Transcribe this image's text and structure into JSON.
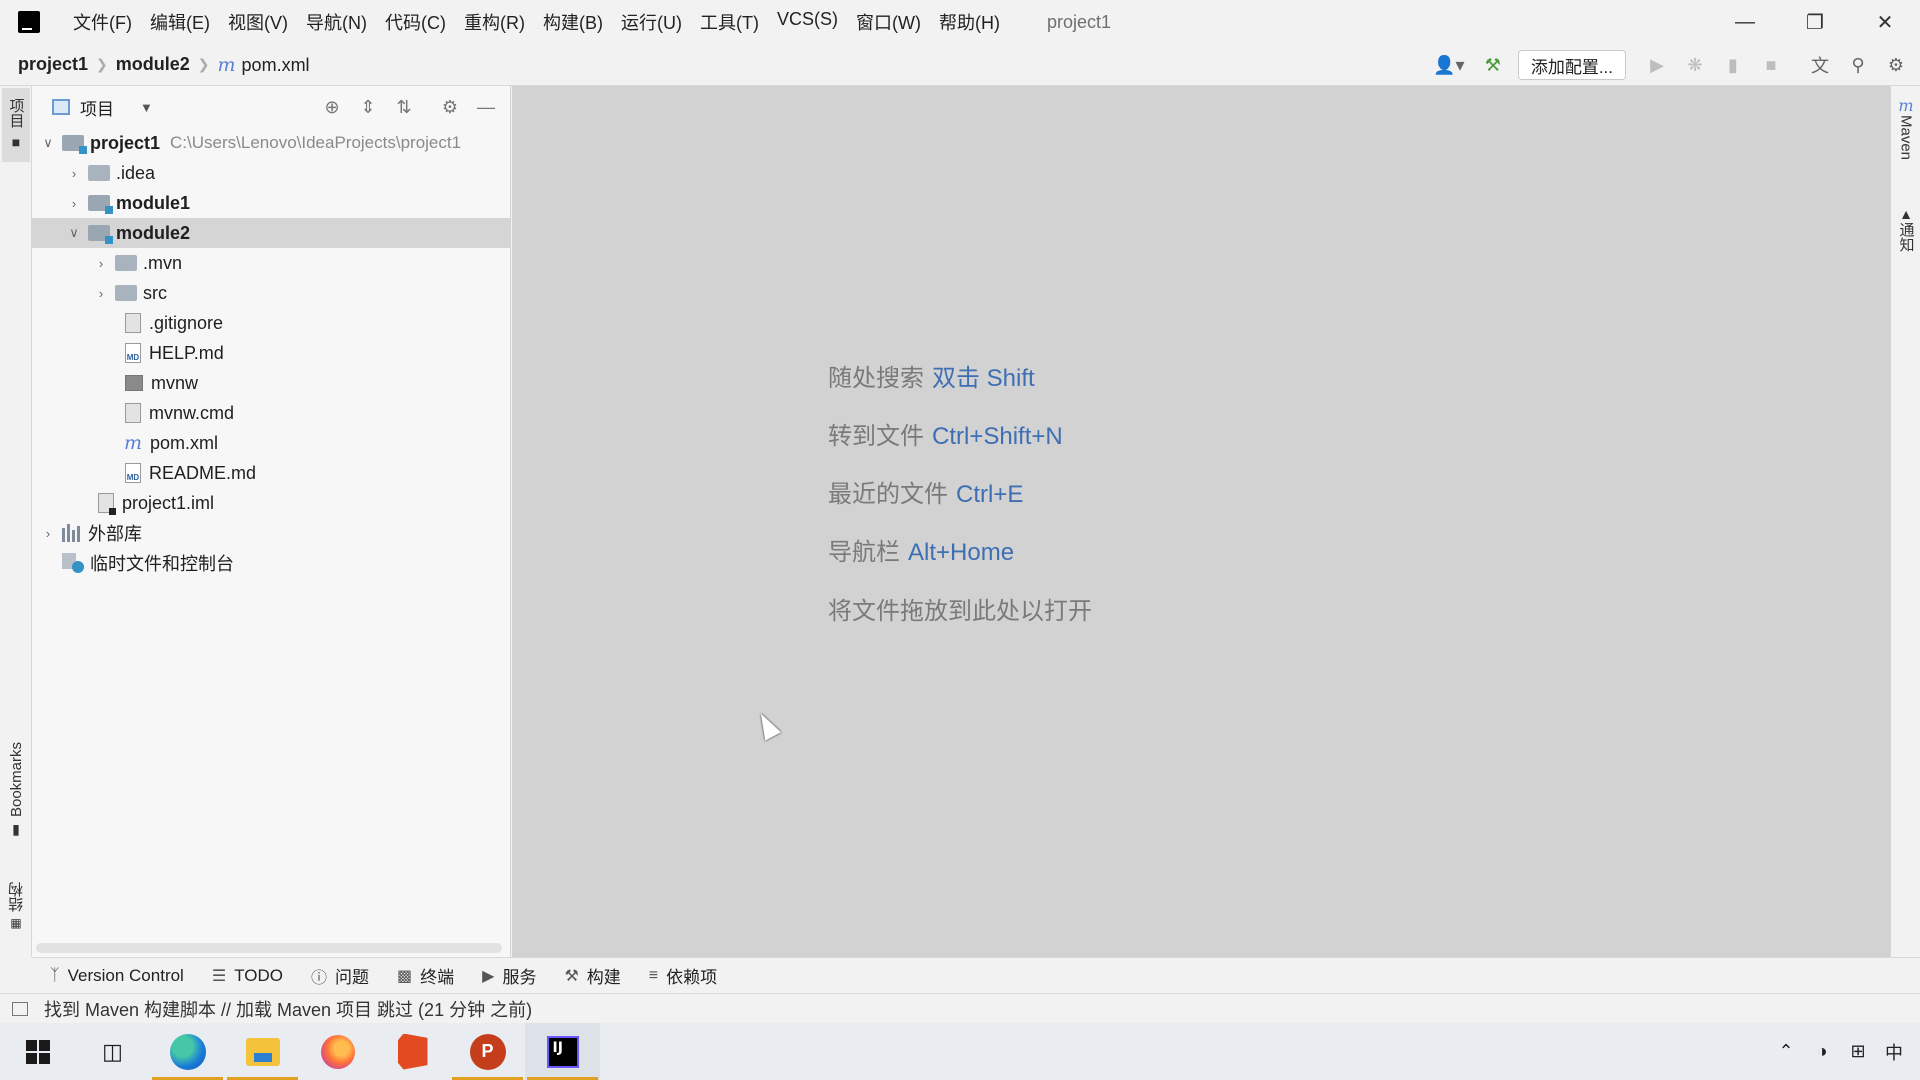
{
  "titlebar": {
    "menu": [
      "文件(F)",
      "编辑(E)",
      "视图(V)",
      "导航(N)",
      "代码(C)",
      "重构(R)",
      "构建(B)",
      "运行(U)",
      "工具(T)",
      "VCS(S)",
      "窗口(W)",
      "帮助(H)"
    ],
    "window_title": "project1"
  },
  "navbar": {
    "crumbs": [
      "project1",
      "module2",
      "pom.xml"
    ],
    "maven_icon_letter": "m",
    "run_config_label": "添加配置..."
  },
  "left_strip": {
    "project_tab": "项目",
    "bookmarks_tab": "Bookmarks",
    "structure_tab": "结构"
  },
  "right_strip": {
    "maven_tab": "Maven",
    "notifications_tab": "通知"
  },
  "project_panel": {
    "title": "项目",
    "tree": [
      {
        "label": "project1",
        "path": "C:\\Users\\Lenovo\\IdeaProjects\\project1"
      },
      {
        "label": ".idea"
      },
      {
        "label": "module1"
      },
      {
        "label": "module2"
      },
      {
        "label": ".mvn"
      },
      {
        "label": "src"
      },
      {
        "label": ".gitignore"
      },
      {
        "label": "HELP.md"
      },
      {
        "label": "mvnw"
      },
      {
        "label": "mvnw.cmd"
      },
      {
        "label": "pom.xml"
      },
      {
        "label": "README.md"
      },
      {
        "label": "project1.iml"
      },
      {
        "label": "外部库"
      },
      {
        "label": "临时文件和控制台"
      }
    ],
    "md_badge": "MD"
  },
  "editor": {
    "hints": [
      {
        "text": "随处搜索",
        "key": "双击 Shift"
      },
      {
        "text": "转到文件",
        "key": "Ctrl+Shift+N"
      },
      {
        "text": "最近的文件",
        "key": "Ctrl+E"
      },
      {
        "text": "导航栏",
        "key": "Alt+Home"
      },
      {
        "text": "将文件拖放到此处以打开",
        "key": ""
      }
    ]
  },
  "tool_windows": [
    "Version Control",
    "TODO",
    "问题",
    "终端",
    "服务",
    "构建",
    "依赖项"
  ],
  "statusbar": {
    "message": "找到 Maven 构建脚本 // 加载 Maven 项目   跳过 (21 分钟 之前)"
  },
  "taskbar": {
    "ppt_letter": "P",
    "ij_letters": "IJ",
    "tray_ime": "中"
  },
  "colors": {
    "editor_bg": "#d2d2d2",
    "shortcut_blue": "#3e6eb3",
    "selection": "#d5d5d5"
  }
}
